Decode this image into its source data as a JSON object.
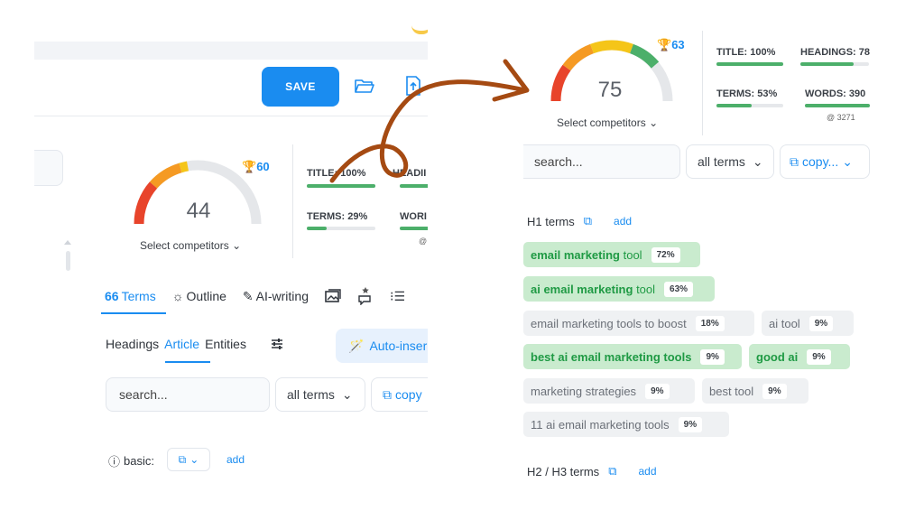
{
  "left": {
    "toolbar": {
      "save_label": "SAVE"
    },
    "score": {
      "value": "44",
      "trophy_value": "60",
      "competitors_label": "Select competitors"
    },
    "metrics": {
      "title": {
        "label": "TITLE: 100%",
        "progress": 1.0
      },
      "headings": {
        "label": "HEADII",
        "progress": 1.0
      },
      "terms": {
        "label": "TERMS: 29%",
        "progress": 0.29
      },
      "words": {
        "label": "WORI",
        "progress": 1.0
      }
    },
    "tabs": [
      {
        "label": "Terms",
        "icon": "quote-icon",
        "active": true
      },
      {
        "label": "Outline",
        "icon": "bulb-icon",
        "active": false
      },
      {
        "label": "AI-writing",
        "icon": "pen-icon",
        "active": false
      },
      {
        "label": "",
        "icon": "image-icon",
        "active": false
      },
      {
        "label": "",
        "icon": "chat-star-icon",
        "active": false
      },
      {
        "label": "",
        "icon": "list-icon",
        "active": false
      }
    ],
    "subtabs": [
      "Headings",
      "Article",
      "Entities"
    ],
    "auto_insert_label": "Auto-inser",
    "search_placeholder": "search...",
    "filter_label": "all terms",
    "copy_label": "copy",
    "basic_label": "basic:",
    "add_label": "add"
  },
  "right": {
    "score": {
      "value": "75",
      "trophy_value": "63",
      "competitors_label": "Select competitors"
    },
    "metrics": {
      "title": {
        "label": "TITLE: 100%",
        "progress": 1.0
      },
      "headings": {
        "label": "HEADINGS: 78",
        "progress": 0.78
      },
      "terms": {
        "label": "TERMS: 53%",
        "progress": 0.53
      },
      "words": {
        "label": "WORDS: 390",
        "progress": 1.0,
        "sub": "3271"
      }
    },
    "search_placeholder": "search...",
    "filter_label": "all terms",
    "copy_label": "copy...",
    "h1_label": "H1 terms",
    "h2_label": "H2 / H3 terms",
    "add_label": "add",
    "chips": [
      {
        "bold": "email marketing",
        "rest": " tool",
        "pct": "72%",
        "style": "green"
      },
      {
        "bold": "ai email marketing",
        "rest": " tool",
        "pct": "63%",
        "style": "green"
      },
      {
        "bold": "",
        "rest": "email marketing tools to boost",
        "pct": "18%",
        "style": "grey"
      },
      {
        "bold": "",
        "rest": "ai tool",
        "pct": "9%",
        "style": "grey"
      },
      {
        "bold": "best ai email marketing tools",
        "rest": "",
        "pct": "9%",
        "style": "green"
      },
      {
        "bold": "good ai",
        "rest": "",
        "pct": "9%",
        "style": "green"
      },
      {
        "bold": "",
        "rest": "marketing strategies",
        "pct": "9%",
        "style": "grey"
      },
      {
        "bold": "",
        "rest": "best tool",
        "pct": "9%",
        "style": "grey"
      },
      {
        "bold": "",
        "rest": "11 ai email marketing tools",
        "pct": "9%",
        "style": "grey"
      }
    ]
  },
  "colors": {
    "accent": "#1a8cf0",
    "green": "#4caf6a",
    "arrow": "#a54a12"
  }
}
